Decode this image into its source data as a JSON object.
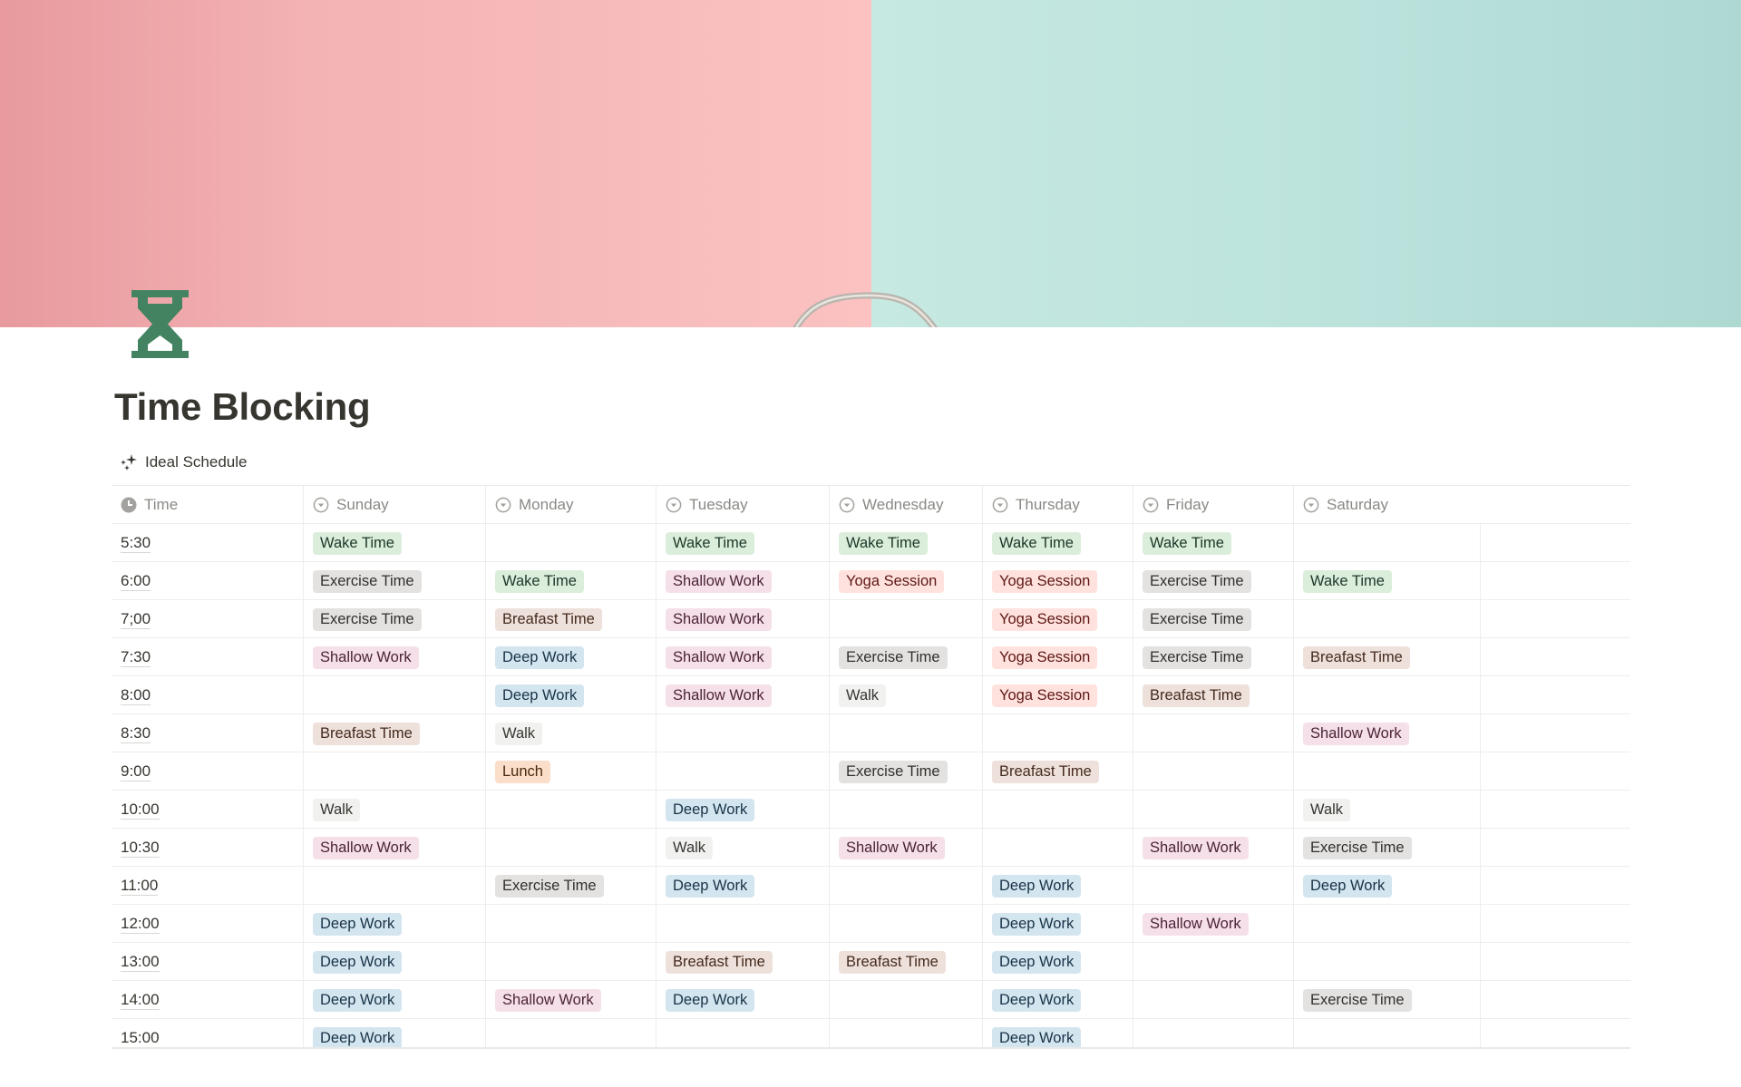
{
  "page": {
    "title": "Time Blocking",
    "icon": "hourglass-icon",
    "icon_color": "#448361",
    "cover": {
      "left_color": "#f7bcbc",
      "right_color": "#bfe4de"
    }
  },
  "view": {
    "label": "Ideal Schedule",
    "icon": "sparkles-icon"
  },
  "table": {
    "columns": [
      {
        "label": "Time",
        "icon": "clock-icon"
      },
      {
        "label": "Sunday",
        "icon": "select-icon"
      },
      {
        "label": "Monday",
        "icon": "select-icon"
      },
      {
        "label": "Tuesday",
        "icon": "select-icon"
      },
      {
        "label": "Wednesday",
        "icon": "select-icon"
      },
      {
        "label": "Thursday",
        "icon": "select-icon"
      },
      {
        "label": "Friday",
        "icon": "select-icon"
      },
      {
        "label": "Saturday",
        "icon": "select-icon"
      }
    ],
    "tag_styles": {
      "Wake Time": {
        "bg": "#dbeddb",
        "fg": "#1c3829"
      },
      "Exercise Time": {
        "bg": "#e3e2e0",
        "fg": "#32302c"
      },
      "Shallow Work": {
        "bg": "#f5e0e9",
        "fg": "#4c2337"
      },
      "Deep Work": {
        "bg": "#d3e5ef",
        "fg": "#183347"
      },
      "Yoga Session": {
        "bg": "#ffe2dd",
        "fg": "#5d1715"
      },
      "Breafast Time": {
        "bg": "#eee0da",
        "fg": "#442a1e"
      },
      "Walk": {
        "bg": "#f1f1ef",
        "fg": "#373530"
      },
      "Lunch": {
        "bg": "#fadec9",
        "fg": "#49290e"
      }
    },
    "rows": [
      {
        "time": "5:30",
        "cells": [
          "Wake Time",
          "",
          "Wake Time",
          "Wake Time",
          "Wake Time",
          "Wake Time",
          ""
        ]
      },
      {
        "time": "6:00",
        "cells": [
          "Exercise Time",
          "Wake Time",
          "Shallow Work",
          "Yoga Session",
          "Yoga Session",
          "Exercise Time",
          "Wake Time"
        ]
      },
      {
        "time": "7;00",
        "cells": [
          "Exercise Time",
          "Breafast Time",
          "Shallow Work",
          "",
          "Yoga Session",
          "Exercise Time",
          ""
        ]
      },
      {
        "time": "7:30",
        "cells": [
          "Shallow Work",
          "Deep Work",
          "Shallow Work",
          "Exercise Time",
          "Yoga Session",
          "Exercise Time",
          "Breafast Time"
        ]
      },
      {
        "time": "8:00",
        "cells": [
          "",
          "Deep Work",
          "Shallow Work",
          "Walk",
          "Yoga Session",
          "Breafast Time",
          ""
        ]
      },
      {
        "time": "8:30",
        "cells": [
          "Breafast Time",
          "Walk",
          "",
          "",
          "",
          "",
          "Shallow Work"
        ]
      },
      {
        "time": "9:00",
        "cells": [
          "",
          "Lunch",
          "",
          "Exercise Time",
          "Breafast Time",
          "",
          ""
        ]
      },
      {
        "time": "10:00",
        "cells": [
          "Walk",
          "",
          "Deep Work",
          "",
          "",
          "",
          "Walk"
        ]
      },
      {
        "time": "10:30",
        "cells": [
          "Shallow Work",
          "",
          "Walk",
          "Shallow Work",
          "",
          "Shallow Work",
          "Exercise Time"
        ]
      },
      {
        "time": "11:00",
        "cells": [
          "",
          "Exercise Time",
          "Deep Work",
          "",
          "Deep Work",
          "",
          "Deep Work"
        ]
      },
      {
        "time": "12:00",
        "cells": [
          "Deep Work",
          "",
          "",
          "",
          "Deep Work",
          "Shallow Work",
          ""
        ]
      },
      {
        "time": "13:00",
        "cells": [
          "Deep Work",
          "",
          "Breafast Time",
          "Breafast Time",
          "Deep Work",
          "",
          ""
        ]
      },
      {
        "time": "14:00",
        "cells": [
          "Deep Work",
          "Shallow Work",
          "Deep Work",
          "",
          "Deep Work",
          "",
          "Exercise Time"
        ]
      },
      {
        "time": "15:00",
        "cells": [
          "Deep Work",
          "",
          "",
          "",
          "Deep Work",
          "",
          ""
        ]
      }
    ]
  }
}
